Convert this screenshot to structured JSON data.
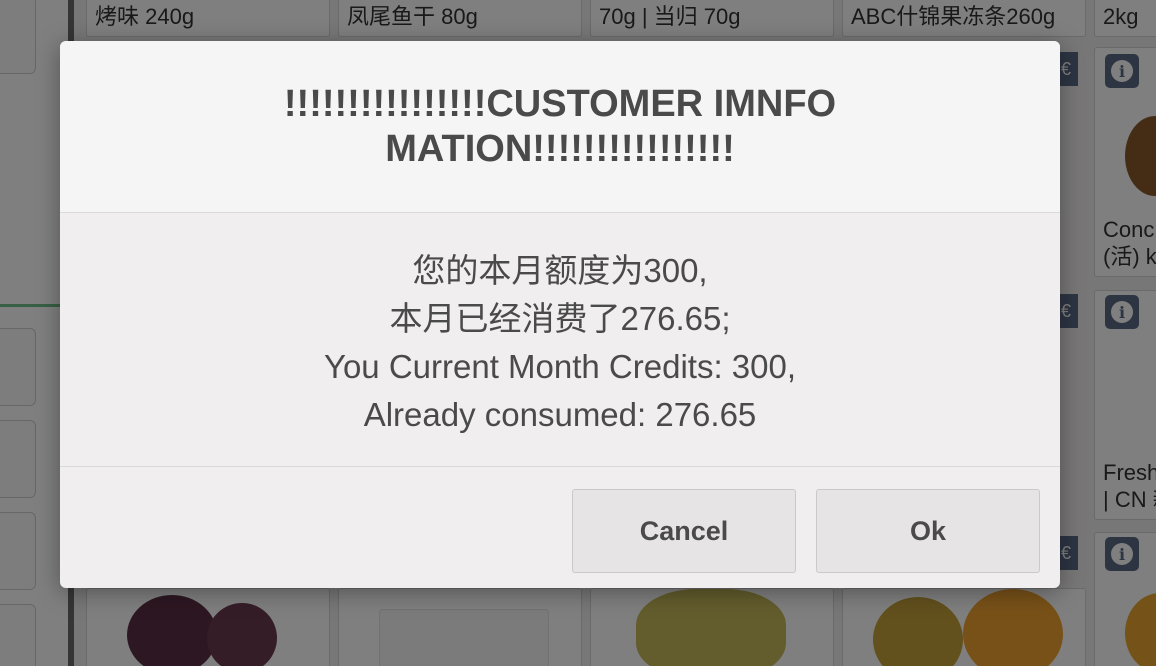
{
  "background": {
    "products": [
      {
        "name": "烤味 240g"
      },
      {
        "name": "凤尾鱼干 80g"
      },
      {
        "name": "70g | 当归 70g"
      },
      {
        "name": "ABC什锦果冻条260g"
      },
      {
        "name": "2kg"
      },
      {
        "name": "Conc\n(活) k"
      },
      {
        "name": "Fresh\n| CN 新"
      }
    ],
    "info_icon": "info-icon",
    "euro_icon": "euro-icon",
    "euro_glyph": "€",
    "info_glyph": "i"
  },
  "modal": {
    "title": "!!!!!!!!!!!!!!!!CUSTOMER IMNFOMATION!!!!!!!!!!!!!!!!",
    "lines": [
      "您的本月额度为300,",
      "本月已经消费了276.65;",
      "You Current Month Credits: 300,",
      "Already consumed: 276.65"
    ],
    "cancel_label": "Cancel",
    "ok_label": "Ok"
  }
}
